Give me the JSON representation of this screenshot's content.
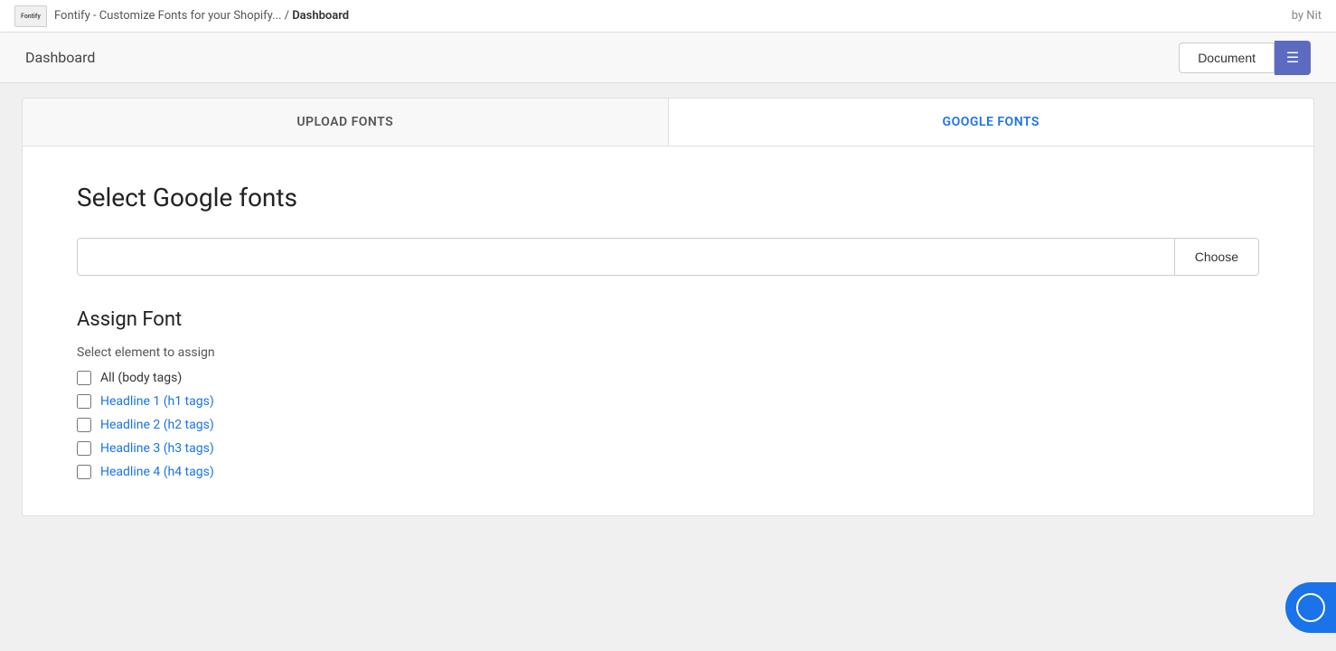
{
  "topbar": {
    "logo_text": "Fontify",
    "breadcrumb_prefix": "Fontify - Customize Fonts for your Shopify... /",
    "breadcrumb_current": "Dashboard",
    "author": "by Nit"
  },
  "header": {
    "title": "Dashboard",
    "document_button": "Document"
  },
  "tabs": [
    {
      "id": "upload-fonts",
      "label": "UPLOAD FONTS",
      "active": false
    },
    {
      "id": "google-fonts",
      "label": "GOOGLE FONTS",
      "active": true
    }
  ],
  "google_fonts_section": {
    "title": "Select Google fonts",
    "search_placeholder": "",
    "choose_button": "Choose",
    "assign_font_title": "Assign Font",
    "select_element_label": "Select element to assign",
    "checkboxes": [
      {
        "id": "all-body",
        "label": "All (body tags)",
        "link": false
      },
      {
        "id": "h1",
        "label": "Headline 1 (h1 tags)",
        "link": true
      },
      {
        "id": "h2",
        "label": "Headline 2 (h2 tags)",
        "link": true
      },
      {
        "id": "h3",
        "label": "Headline 3 (h3 tags)",
        "link": true
      },
      {
        "id": "h4",
        "label": "Headline 4 (h4 tags)",
        "link": true
      }
    ]
  },
  "colors": {
    "tab_active": "#1a73e8",
    "link_blue": "#1a73e8",
    "purple_btn": "#5c6bc0"
  }
}
